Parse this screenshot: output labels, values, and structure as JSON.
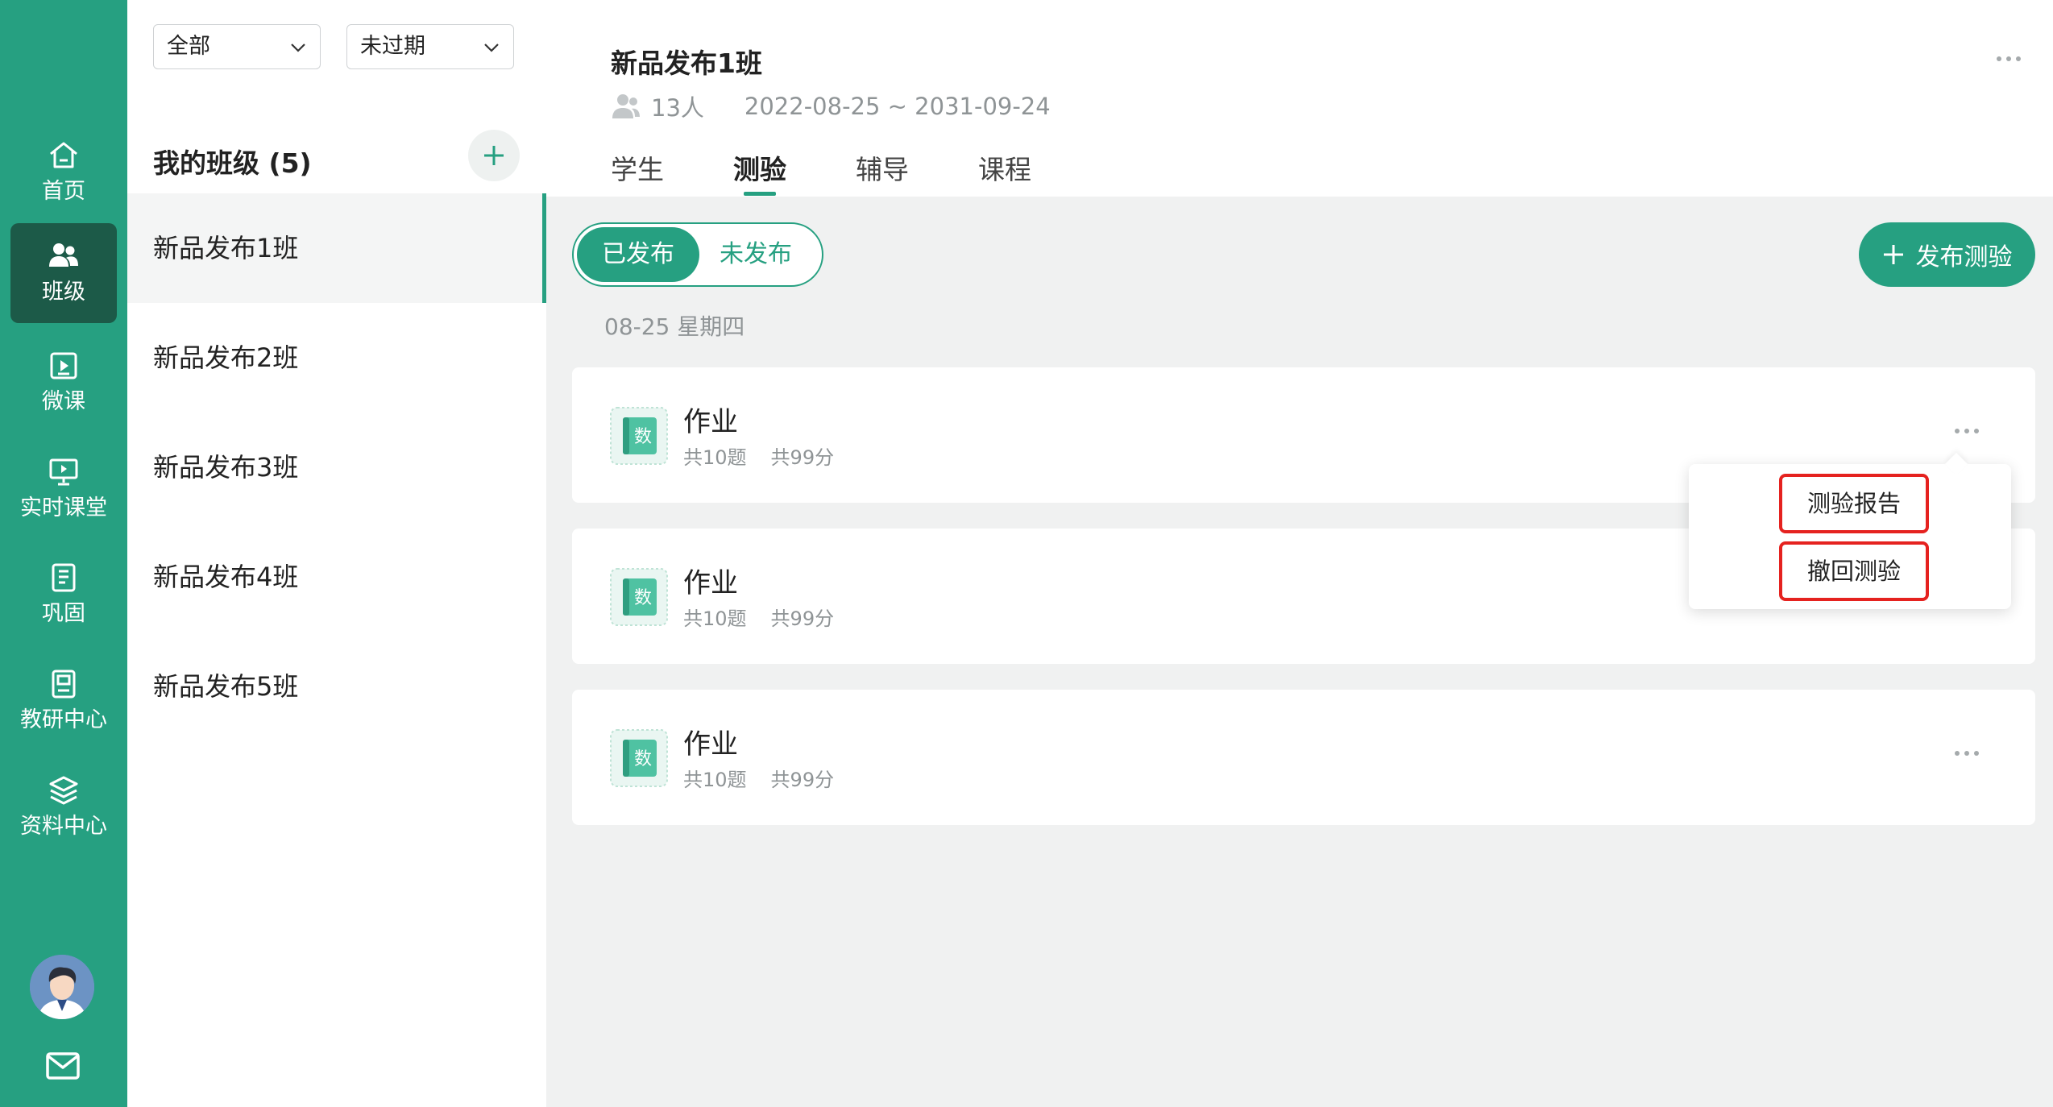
{
  "sidebar": {
    "items": [
      {
        "label": "首页",
        "icon": "home-icon"
      },
      {
        "label": "班级",
        "icon": "users-icon",
        "active": true
      },
      {
        "label": "微课",
        "icon": "video-icon"
      },
      {
        "label": "实时课堂",
        "icon": "whiteboard-icon"
      },
      {
        "label": "巩固",
        "icon": "notebook-icon"
      },
      {
        "label": "教研中心",
        "icon": "book-icon"
      },
      {
        "label": "资料中心",
        "icon": "layers-icon"
      }
    ],
    "accent_color": "#26a081",
    "active_bg": "#1c5a48"
  },
  "filters": {
    "scope_value": "全部",
    "status_value": "未过期"
  },
  "class_list": {
    "heading": "我的班级 (5)",
    "items": [
      "新品发布1班",
      "新品发布2班",
      "新品发布3班",
      "新品发布4班",
      "新品发布5班"
    ]
  },
  "header": {
    "title": "新品发布1班",
    "member_count": "13人",
    "date_range": "2022-08-25 ~ 2031-09-24",
    "tabs": [
      "学生",
      "测验",
      "辅导",
      "课程"
    ],
    "active_tab": "测验"
  },
  "content": {
    "toggle": {
      "published": "已发布",
      "unpublished": "未发布"
    },
    "publish_button": "发布测验",
    "date_label": "08-25 星期四",
    "cards": [
      {
        "subject_badge": "数",
        "title": "作业",
        "questions": "共10题",
        "score": "共99分"
      },
      {
        "subject_badge": "数",
        "title": "作业",
        "questions": "共10题",
        "score": "共99分"
      },
      {
        "subject_badge": "数",
        "title": "作业",
        "questions": "共10题",
        "score": "共99分"
      }
    ],
    "popup_menu": [
      "测验报告",
      "撤回测验"
    ],
    "highlight_color": "#e5221f"
  }
}
